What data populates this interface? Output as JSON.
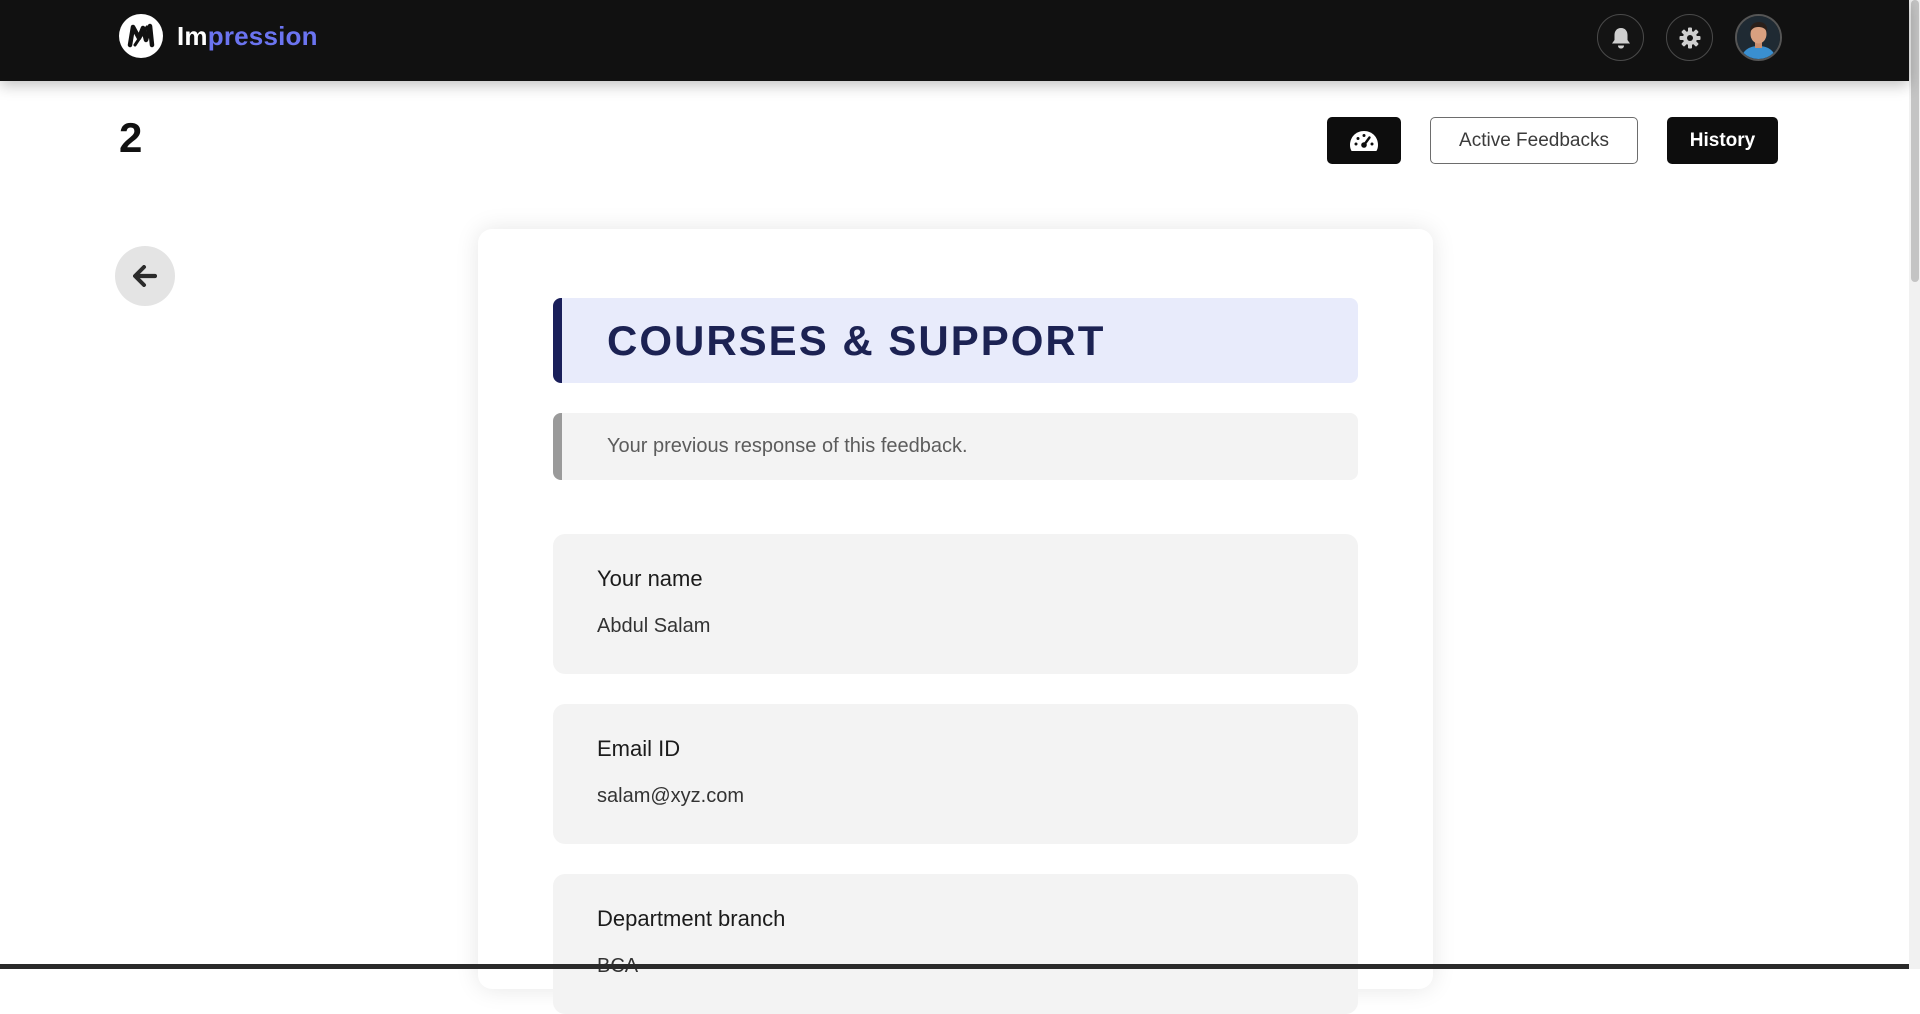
{
  "brand": {
    "name_part1": "Im",
    "name_part2": "pression",
    "logo_icon": "impression-logo-icon"
  },
  "navbar": {
    "notification_icon": "bell-icon",
    "settings_icon": "gear-icon",
    "avatar_icon": "user-avatar"
  },
  "subheader": {
    "page_number": "2",
    "dashboard_icon": "speedometer-icon",
    "active_feedbacks_label": "Active Feedbacks",
    "history_label": "History"
  },
  "back_button": {
    "icon": "arrow-left-icon"
  },
  "form": {
    "title": "COURSES & SUPPORT",
    "note": "Your previous response of this feedback.",
    "fields": [
      {
        "label": "Your name",
        "value": "Abdul Salam"
      },
      {
        "label": "Email ID",
        "value": "salam@xyz.com"
      },
      {
        "label": "Department branch",
        "value": "BCA"
      }
    ]
  },
  "colors": {
    "navbar_bg": "#111111",
    "brand_accent": "#6b74f0",
    "title_bg": "#e8ebfb",
    "title_text": "#1c2253",
    "field_bg": "#f3f3f3"
  }
}
